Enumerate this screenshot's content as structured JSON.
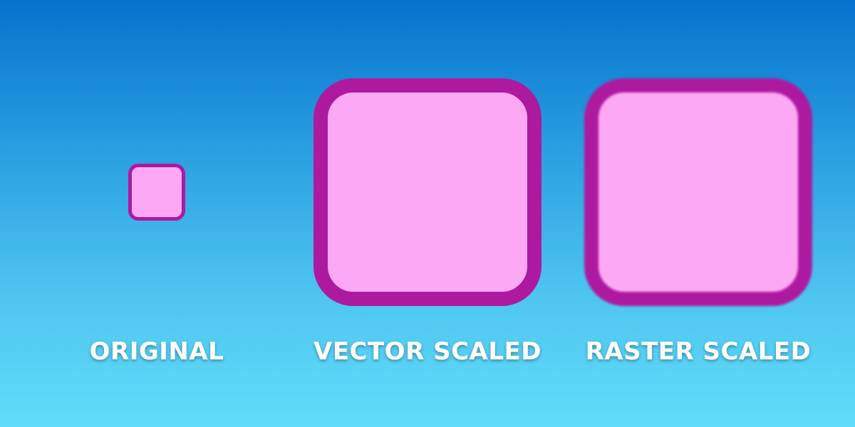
{
  "colors": {
    "background_top": "#0573cd",
    "background_bottom": "#61dcfa",
    "square_fill": "#fca8f4",
    "square_border": "#ad1aa0",
    "label_text": "#ffffff"
  },
  "items": [
    {
      "label": "ORIGINAL"
    },
    {
      "label": "VECTOR SCALED"
    },
    {
      "label": "RASTER SCALED"
    }
  ]
}
